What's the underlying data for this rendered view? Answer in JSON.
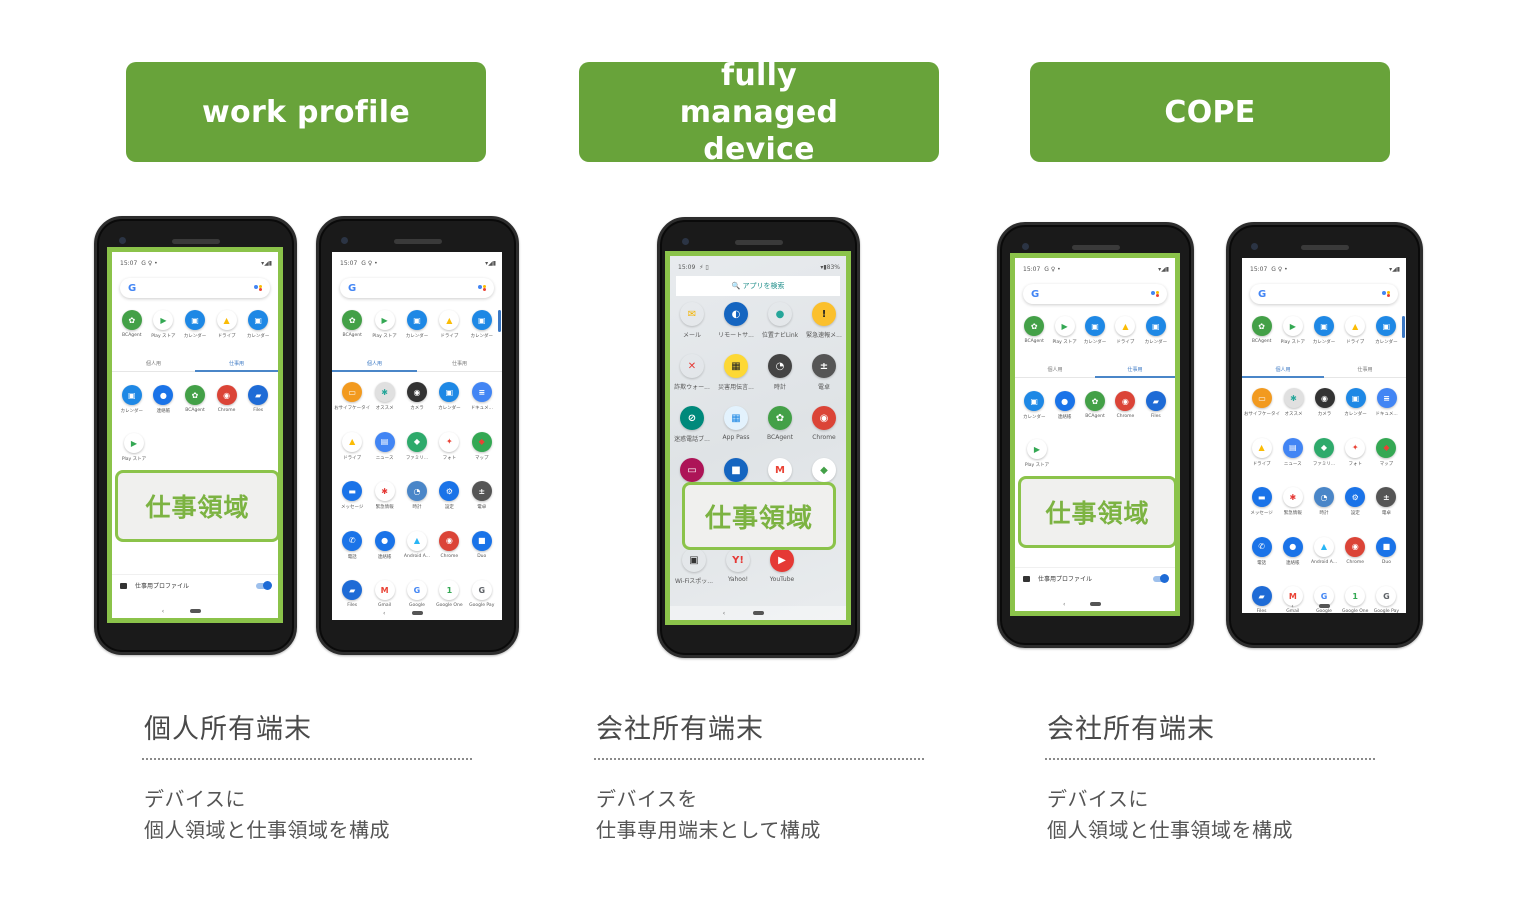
{
  "columns": [
    {
      "header": "work profile",
      "caption_title": "個人所有端末",
      "caption_desc_line1": "デバイスに",
      "caption_desc_line2": "個人領域と仕事領域を構成"
    },
    {
      "header": "fully managed device",
      "caption_title": "会社所有端末",
      "caption_desc_line1": "デバイスを",
      "caption_desc_line2": "仕事専用端末として構成"
    },
    {
      "header": "COPE",
      "caption_title": "会社所有端末",
      "caption_desc_line1": "デバイスに",
      "caption_desc_line2": "個人領域と仕事領域を構成"
    }
  ],
  "colors": {
    "header_bg": "#68a33a",
    "work_area_outline": "#8bc34a",
    "work_area_text": "#7cb342",
    "tab_active": "#3b78c4"
  },
  "work_area_label": "仕事領域",
  "profile_phone": {
    "status_time": "15:07",
    "status_icons": "G ♀ •",
    "status_right": "▾◢▮",
    "google_logo": "G",
    "tabs": [
      "個人用",
      "仕事用"
    ],
    "top_apps": [
      "BCAgent",
      "Play ストア",
      "カレンダー",
      "ドライブ",
      "カレンダー"
    ],
    "work_apps_row1": [
      "カレンダー",
      "連絡帳",
      "BCAgent",
      "Chrome",
      "Files"
    ],
    "work_apps_row2": [
      "Play ストア"
    ],
    "work_profile_label": "仕事用プロファイル",
    "nav_back": "‹"
  },
  "personal_phone": {
    "status_time": "15:07",
    "status_icons": "G ♀ •",
    "status_right": "▾◢▮",
    "google_logo": "G",
    "tabs": [
      "個人用",
      "仕事用"
    ],
    "top_apps": [
      "BCAgent",
      "Play ストア",
      "カレンダー",
      "ドライブ",
      "カレンダー"
    ],
    "rows": [
      [
        "おサイフケータイ",
        "オススメ",
        "カメラ",
        "カレンダー",
        "ドキュメ..."
      ],
      [
        "ドライブ",
        "ニュース",
        "ファミリ...",
        "フォト",
        "マップ"
      ],
      [
        "メッセージ",
        "緊急情報",
        "時計",
        "設定",
        "電卓"
      ],
      [
        "電話",
        "連絡帳",
        "Android A...",
        "Chrome",
        "Duo"
      ],
      [
        "Files",
        "Gmail",
        "Google",
        "Google One",
        "Google Pay"
      ]
    ],
    "nav_back": "‹"
  },
  "managed_phone": {
    "status_time": "15:09",
    "status_icons": "⚡ ▯",
    "status_right": "▾▮83%",
    "search_label": "🔍 アプリを検索",
    "rows": [
      [
        "メール",
        "リモートサ...",
        "位置ナビLink",
        "緊急速報メ..."
      ],
      [
        "詐欺ウォー...",
        "災害用伝言...",
        "時計",
        "電卓"
      ],
      [
        "迷惑電話ブ...",
        "App Pass",
        "BCAgent",
        "Chrome"
      ],
      [
        "",
        "",
        "",
        ""
      ],
      [
        "Wi-Fiスポッ...",
        "Yahoo!",
        "YouTube"
      ]
    ],
    "nav_back": "‹"
  }
}
